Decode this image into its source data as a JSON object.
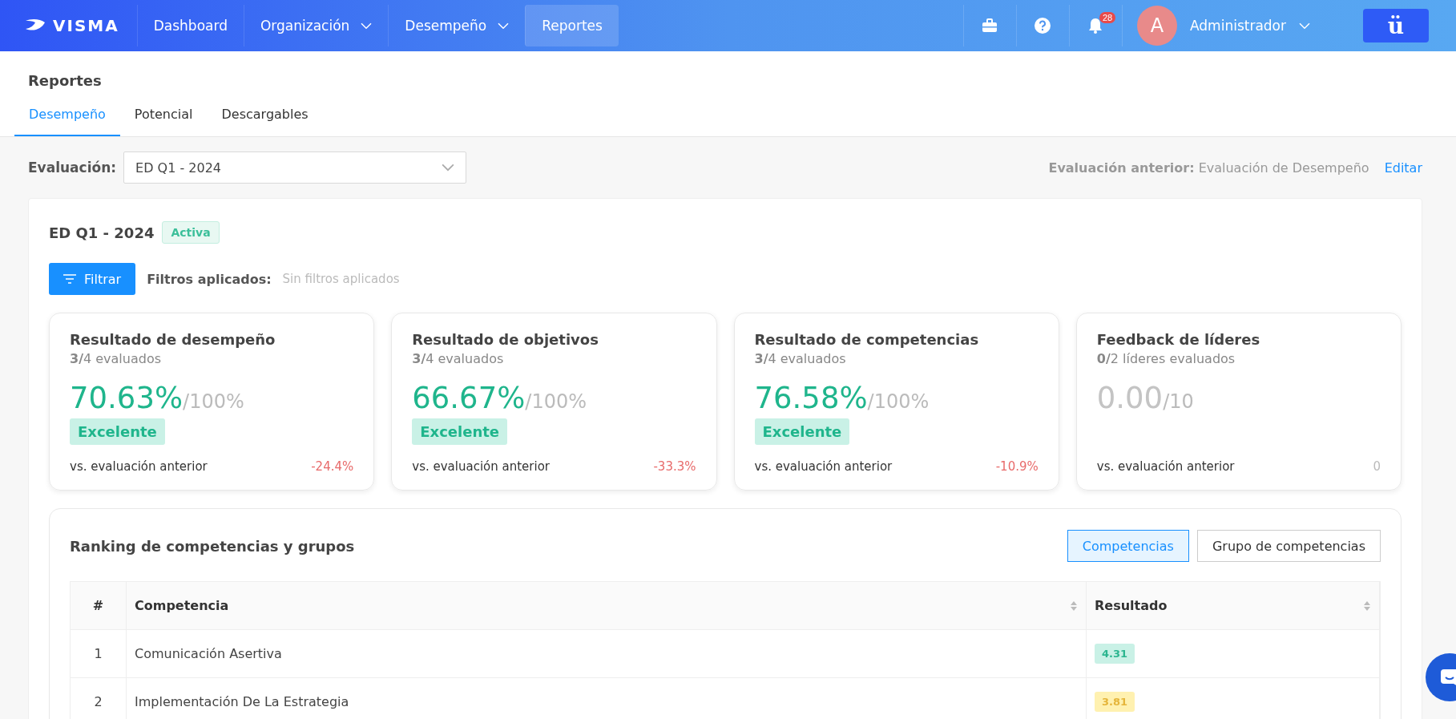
{
  "nav": {
    "logo": "VISMA",
    "items": [
      {
        "label": "Dashboard",
        "has_menu": false,
        "selected": false
      },
      {
        "label": "Organización",
        "has_menu": true,
        "selected": false
      },
      {
        "label": "Desempeño",
        "has_menu": true,
        "selected": false
      },
      {
        "label": "Reportes",
        "has_menu": false,
        "selected": true
      }
    ],
    "notification_count": "28",
    "avatar_letter": "A",
    "user": "Administrador",
    "app_button": "ü"
  },
  "page": {
    "title": "Reportes",
    "tabs": [
      {
        "label": "Desempeño",
        "selected": true
      },
      {
        "label": "Potencial",
        "selected": false
      },
      {
        "label": "Descargables",
        "selected": false
      }
    ]
  },
  "evaluation": {
    "label": "Evaluación:",
    "value": "ED Q1 - 2024",
    "previous_label": "Evaluación anterior:",
    "previous_value": "Evaluación de Desempeño",
    "edit": "Editar"
  },
  "summary": {
    "title": "ED Q1 - 2024",
    "status": "Activa",
    "filter_button": "Filtrar",
    "filters_label": "Filtros aplicados:",
    "filters_value": "Sin filtros aplicados",
    "cards": [
      {
        "title": "Resultado de desempeño",
        "done": "3/",
        "count": "4 evaluados",
        "value": "70.63%",
        "scale": "/100%",
        "has_result": true,
        "rating": "Excelente",
        "compare": "vs. evaluación anterior",
        "delta": "-24.4%",
        "negative": true
      },
      {
        "title": "Resultado de objetivos",
        "done": "3/",
        "count": "4 evaluados",
        "value": "66.67%",
        "scale": "/100%",
        "has_result": true,
        "rating": "Excelente",
        "compare": "vs. evaluación anterior",
        "delta": "-33.3%",
        "negative": true
      },
      {
        "title": "Resultado de competencias",
        "done": "3/",
        "count": "4 evaluados",
        "value": "76.58%",
        "scale": "/100%",
        "has_result": true,
        "rating": "Excelente",
        "compare": "vs. evaluación anterior",
        "delta": "-10.9%",
        "negative": true
      },
      {
        "title": "Feedback de líderes",
        "done": "0/",
        "count": "2 líderes evaluados",
        "value": "0.00",
        "scale": "/10",
        "has_result": false,
        "compare": "vs. evaluación anterior",
        "delta": "0",
        "negative": false
      }
    ]
  },
  "ranking": {
    "title": "Ranking de competencias y grupos",
    "toggle": [
      {
        "label": "Competencias",
        "selected": true
      },
      {
        "label": "Grupo de competencias",
        "selected": false
      }
    ],
    "columns": [
      {
        "label": "#",
        "sortable": false
      },
      {
        "label": "Competencia",
        "sortable": true
      },
      {
        "label": "Resultado",
        "sortable": true
      }
    ],
    "rows": [
      {
        "rank": "1",
        "name": "Comunicación Asertiva",
        "result": "4.31",
        "color": "#2bb58f"
      },
      {
        "rank": "2",
        "name": "Implementación De La Estrategia",
        "result": "3.81",
        "color": "#e5b53a"
      }
    ]
  }
}
